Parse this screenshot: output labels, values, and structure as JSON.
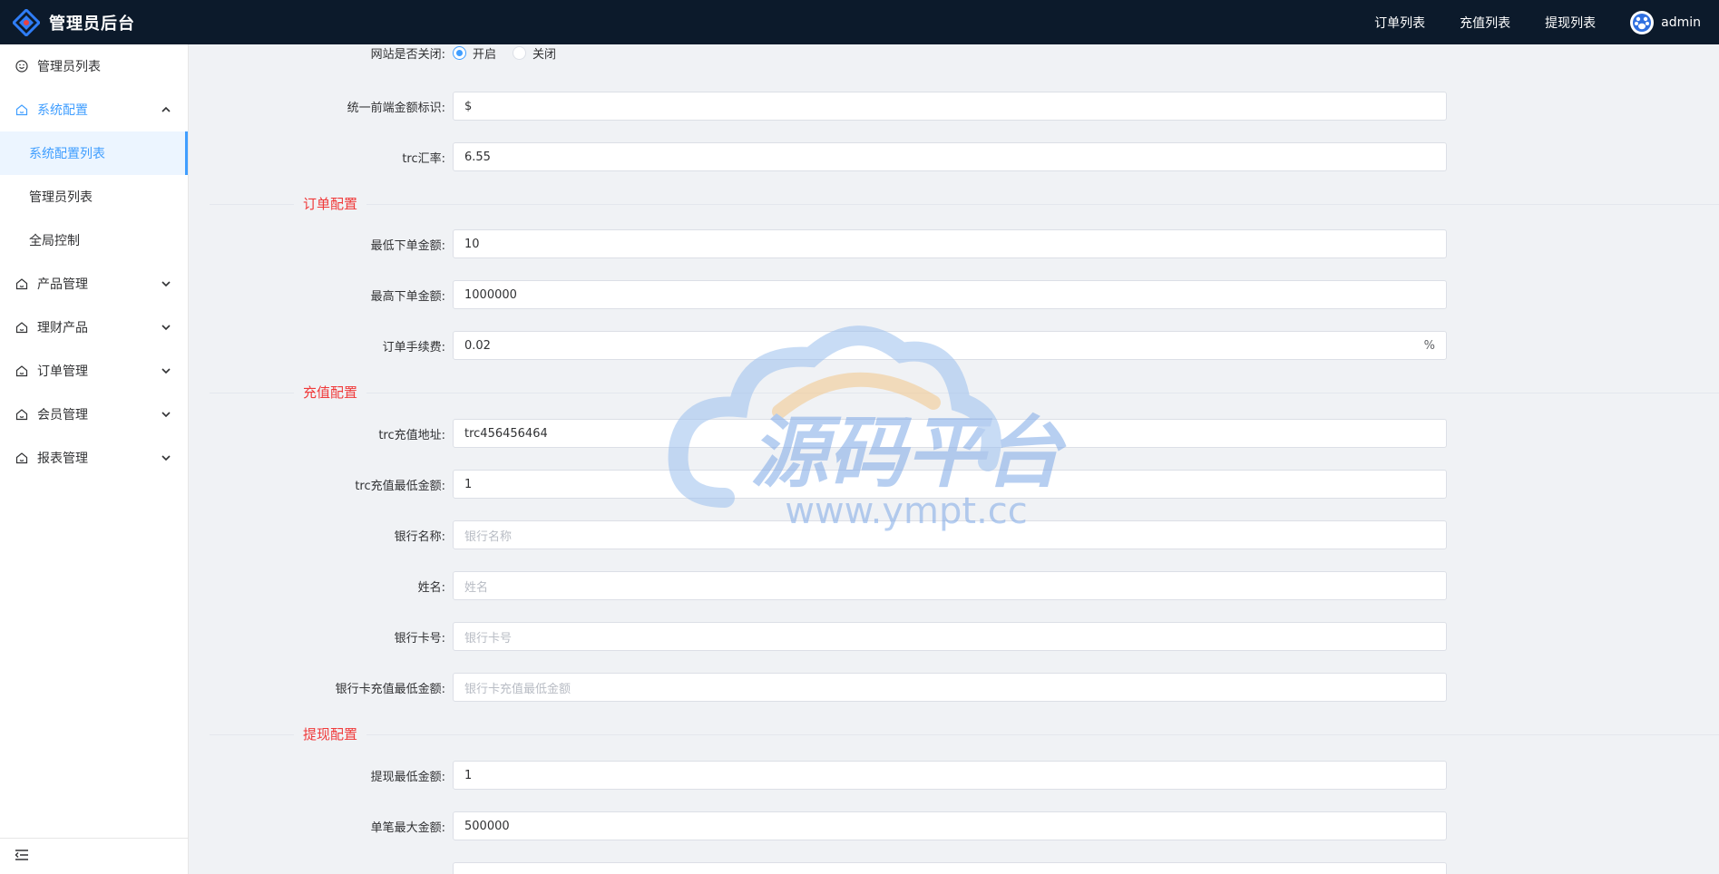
{
  "header": {
    "title": "管理员后台",
    "nav": [
      "订单列表",
      "充值列表",
      "提现列表"
    ],
    "user": "admin"
  },
  "sidebar": {
    "items": [
      {
        "label": "管理员列表",
        "icon": "smile-icon"
      },
      {
        "label": "系统配置",
        "icon": "home-icon",
        "open": true
      },
      {
        "label": "产品管理",
        "icon": "home-icon"
      },
      {
        "label": "理财产品",
        "icon": "home-icon"
      },
      {
        "label": "订单管理",
        "icon": "home-icon"
      },
      {
        "label": "会员管理",
        "icon": "home-icon"
      },
      {
        "label": "报表管理",
        "icon": "home-icon"
      }
    ],
    "subitems": [
      "系统配置列表",
      "管理员列表",
      "全局控制"
    ],
    "active_subitem": "系统配置列表"
  },
  "form": {
    "site_closed": {
      "label": "网站是否关闭:",
      "options": [
        "开启",
        "关闭"
      ],
      "selected": "开启"
    },
    "currency_symbol": {
      "label": "统一前端金额标识:",
      "value": "$"
    },
    "trc_rate": {
      "label": "trc汇率:",
      "value": "6.55"
    },
    "section_order": "订单配置",
    "min_order": {
      "label": "最低下单金额:",
      "value": "10"
    },
    "max_order": {
      "label": "最高下单金额:",
      "value": "1000000"
    },
    "order_fee": {
      "label": "订单手续费:",
      "value": "0.02",
      "suffix": "%"
    },
    "section_recharge": "充值配置",
    "trc_address": {
      "label": "trc充值地址:",
      "value": "trc456456464"
    },
    "trc_min": {
      "label": "trc充值最低金额:",
      "value": "1"
    },
    "bank_name": {
      "label": "银行名称:",
      "placeholder": "银行名称"
    },
    "holder_name": {
      "label": "姓名:",
      "placeholder": "姓名"
    },
    "bank_card": {
      "label": "银行卡号:",
      "placeholder": "银行卡号"
    },
    "bank_min": {
      "label": "银行卡充值最低金额:",
      "placeholder": "银行卡充值最低金额"
    },
    "section_withdraw": "提现配置",
    "withdraw_min": {
      "label": "提现最低金额:",
      "value": "1"
    },
    "single_max": {
      "label": "单笔最大金额:",
      "value": "500000"
    }
  },
  "watermark": {
    "title": "源码平台",
    "url": "www.ympt.cc"
  },
  "colors": {
    "header_bg": "#0c1a2b",
    "accent": "#409eff",
    "section_title": "#f03a3a"
  }
}
